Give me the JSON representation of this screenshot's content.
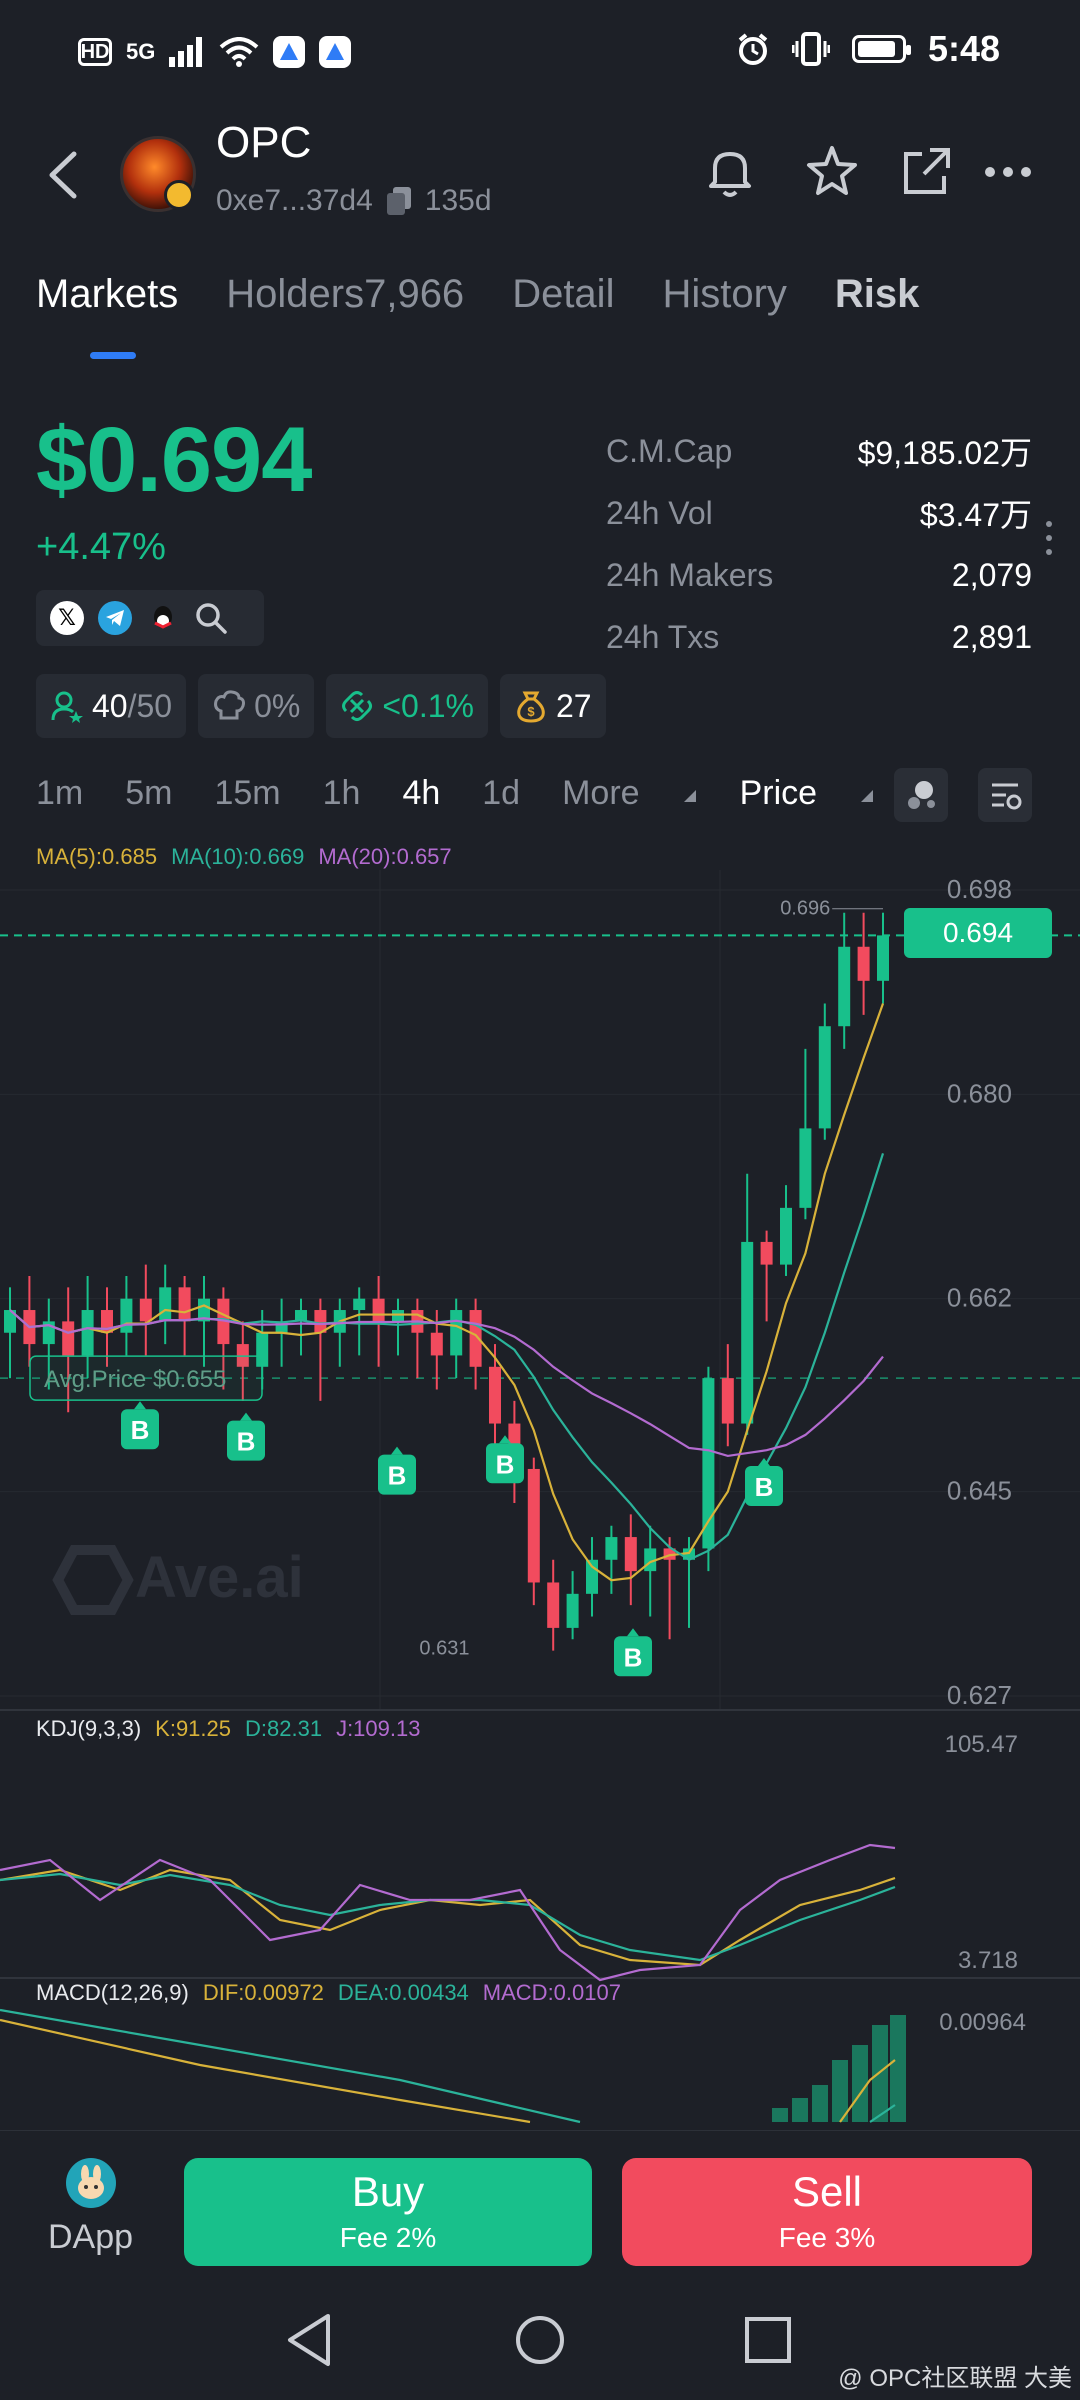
{
  "status_bar": {
    "time": "5:48",
    "hd": "HD",
    "network": "5G"
  },
  "header": {
    "token_name": "OPC",
    "address": "0xe7...37d4",
    "age": "135d"
  },
  "tabs": [
    {
      "label": "Markets",
      "active": true
    },
    {
      "label": "Holders7,966",
      "active": false
    },
    {
      "label": "Detail",
      "active": false
    },
    {
      "label": "History",
      "active": false
    },
    {
      "label": "Risk",
      "active": false
    }
  ],
  "price": {
    "value": "$0.694",
    "change": "+4.47%"
  },
  "stats": [
    {
      "label": "C.M.Cap",
      "value": "$9,185.02万"
    },
    {
      "label": "24h Vol",
      "value": "$3.47万"
    },
    {
      "label": "24h Makers",
      "value": "2,079"
    },
    {
      "label": "24h Txs",
      "value": "2,891"
    }
  ],
  "badges": {
    "holders_ratio_a": "40",
    "holders_ratio_b": "/50",
    "dev": "0%",
    "bundle": "<0.1%",
    "insiders": "27"
  },
  "timeframes": {
    "items": [
      "1m",
      "5m",
      "15m",
      "1h",
      "4h",
      "1d"
    ],
    "active": "4h",
    "more": "More",
    "price": "Price"
  },
  "ma_legend": {
    "ma5": "MA(5):0.685",
    "ma10": "MA(10):0.669",
    "ma20": "MA(20):0.657"
  },
  "colors": {
    "up": "#18c08b",
    "down": "#f24b5e",
    "ma5": "#d8b23a",
    "ma10": "#2bb39a",
    "ma20": "#b36bd0",
    "background": "#1d2027"
  },
  "chart_labels": {
    "watermark": "Ave.ai",
    "avg_price": "Avg.Price $0.655",
    "buy_marker": "B",
    "high_label": "0.696",
    "low_label": "0.631",
    "current_tag": "0.694"
  },
  "kdj_legend": {
    "name": "KDJ(9,3,3)",
    "k": "K:91.25",
    "d": "D:82.31",
    "j": "J:109.13"
  },
  "macd_legend": {
    "name": "MACD(12,26,9)",
    "dif": "DIF:0.00972",
    "dea": "DEA:0.00434",
    "macd": "MACD:0.0107"
  },
  "chart_data": {
    "type": "candlestick",
    "y_ticks": [
      "0.698",
      "0.680",
      "0.662",
      "0.645",
      "0.627"
    ],
    "ylim": [
      0.627,
      0.698
    ],
    "current_price": 0.694,
    "avg_price": 0.655,
    "candles": [
      {
        "o": 0.659,
        "c": 0.661,
        "h": 0.663,
        "l": 0.655
      },
      {
        "o": 0.661,
        "c": 0.658,
        "h": 0.664,
        "l": 0.656
      },
      {
        "o": 0.658,
        "c": 0.66,
        "h": 0.662,
        "l": 0.654
      },
      {
        "o": 0.66,
        "c": 0.657,
        "h": 0.663,
        "l": 0.652
      },
      {
        "o": 0.657,
        "c": 0.661,
        "h": 0.664,
        "l": 0.655
      },
      {
        "o": 0.661,
        "c": 0.659,
        "h": 0.663,
        "l": 0.656
      },
      {
        "o": 0.659,
        "c": 0.662,
        "h": 0.664,
        "l": 0.657
      },
      {
        "o": 0.662,
        "c": 0.66,
        "h": 0.665,
        "l": 0.657
      },
      {
        "o": 0.66,
        "c": 0.663,
        "h": 0.665,
        "l": 0.658
      },
      {
        "o": 0.663,
        "c": 0.66,
        "h": 0.664,
        "l": 0.657
      },
      {
        "o": 0.66,
        "c": 0.662,
        "h": 0.664,
        "l": 0.656
      },
      {
        "o": 0.662,
        "c": 0.658,
        "h": 0.663,
        "l": 0.654
      },
      {
        "o": 0.658,
        "c": 0.656,
        "h": 0.66,
        "l": 0.653
      },
      {
        "o": 0.656,
        "c": 0.659,
        "h": 0.661,
        "l": 0.654
      },
      {
        "o": 0.659,
        "c": 0.66,
        "h": 0.662,
        "l": 0.656
      },
      {
        "o": 0.66,
        "c": 0.661,
        "h": 0.662,
        "l": 0.657
      },
      {
        "o": 0.661,
        "c": 0.659,
        "h": 0.662,
        "l": 0.653
      },
      {
        "o": 0.659,
        "c": 0.661,
        "h": 0.662,
        "l": 0.656
      },
      {
        "o": 0.661,
        "c": 0.662,
        "h": 0.663,
        "l": 0.657
      },
      {
        "o": 0.662,
        "c": 0.66,
        "h": 0.664,
        "l": 0.656
      },
      {
        "o": 0.66,
        "c": 0.661,
        "h": 0.662,
        "l": 0.657
      },
      {
        "o": 0.661,
        "c": 0.659,
        "h": 0.662,
        "l": 0.655
      },
      {
        "o": 0.659,
        "c": 0.657,
        "h": 0.661,
        "l": 0.654
      },
      {
        "o": 0.657,
        "c": 0.661,
        "h": 0.662,
        "l": 0.655
      },
      {
        "o": 0.661,
        "c": 0.656,
        "h": 0.662,
        "l": 0.654
      },
      {
        "o": 0.656,
        "c": 0.651,
        "h": 0.658,
        "l": 0.649
      },
      {
        "o": 0.651,
        "c": 0.647,
        "h": 0.653,
        "l": 0.644
      },
      {
        "o": 0.647,
        "c": 0.637,
        "h": 0.648,
        "l": 0.635
      },
      {
        "o": 0.637,
        "c": 0.633,
        "h": 0.639,
        "l": 0.631
      },
      {
        "o": 0.633,
        "c": 0.636,
        "h": 0.638,
        "l": 0.632
      },
      {
        "o": 0.636,
        "c": 0.639,
        "h": 0.641,
        "l": 0.634
      },
      {
        "o": 0.639,
        "c": 0.641,
        "h": 0.642,
        "l": 0.636
      },
      {
        "o": 0.641,
        "c": 0.638,
        "h": 0.643,
        "l": 0.635
      },
      {
        "o": 0.638,
        "c": 0.64,
        "h": 0.642,
        "l": 0.634
      },
      {
        "o": 0.64,
        "c": 0.639,
        "h": 0.641,
        "l": 0.632
      },
      {
        "o": 0.639,
        "c": 0.64,
        "h": 0.641,
        "l": 0.633
      },
      {
        "o": 0.64,
        "c": 0.655,
        "h": 0.656,
        "l": 0.638
      },
      {
        "o": 0.655,
        "c": 0.651,
        "h": 0.658,
        "l": 0.649
      },
      {
        "o": 0.651,
        "c": 0.667,
        "h": 0.673,
        "l": 0.65
      },
      {
        "o": 0.667,
        "c": 0.665,
        "h": 0.668,
        "l": 0.66
      },
      {
        "o": 0.665,
        "c": 0.67,
        "h": 0.672,
        "l": 0.664
      },
      {
        "o": 0.67,
        "c": 0.677,
        "h": 0.684,
        "l": 0.669
      },
      {
        "o": 0.677,
        "c": 0.686,
        "h": 0.688,
        "l": 0.676
      },
      {
        "o": 0.686,
        "c": 0.693,
        "h": 0.696,
        "l": 0.684
      },
      {
        "o": 0.693,
        "c": 0.69,
        "h": 0.696,
        "l": 0.687
      },
      {
        "o": 0.69,
        "c": 0.694,
        "h": 0.696,
        "l": 0.688
      }
    ],
    "kdj": {
      "y_ticks": [
        "105.47",
        "3.718"
      ]
    },
    "macd": {
      "y_ticks": [
        "0.00964"
      ]
    }
  },
  "bottom_bar": {
    "dapp_label": "DApp",
    "buy_label": "Buy",
    "buy_fee": "Fee 2%",
    "sell_label": "Sell",
    "sell_fee": "Fee 3%"
  },
  "watermark": "@ OPC社区联盟 大美"
}
